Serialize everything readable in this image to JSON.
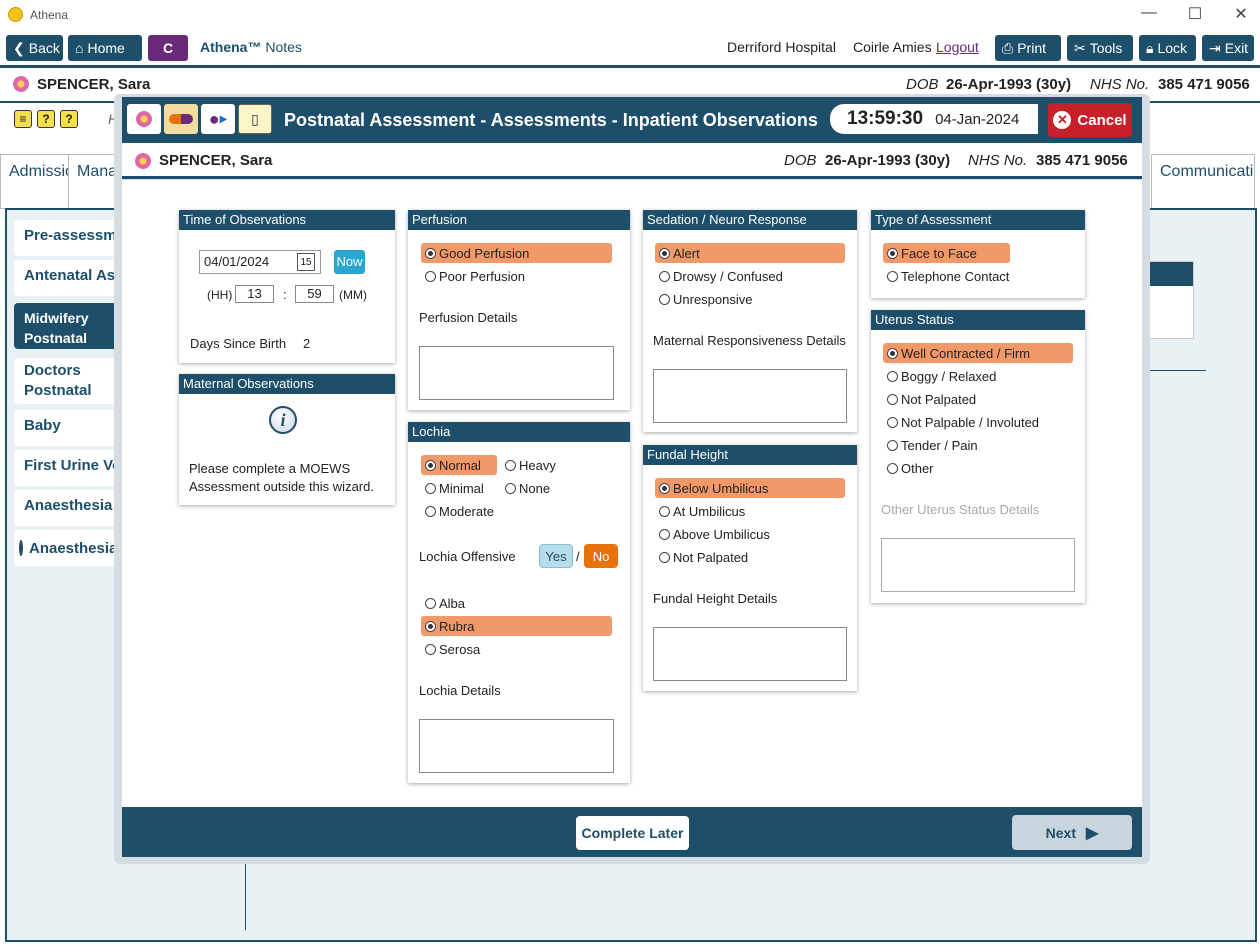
{
  "app": {
    "title": "Athena"
  },
  "toolbar": {
    "back": "Back",
    "home": "Home",
    "c": "C",
    "app_name": "Athena™",
    "app_sub": "Notes",
    "hospital": "Derriford Hospital",
    "user": "Coirle Amies",
    "logout": "Logout",
    "print": "Print",
    "tools": "Tools",
    "lock": "Lock",
    "exit": "Exit"
  },
  "patient": {
    "name": "SPENCER, Sara",
    "dob_label": "DOB",
    "dob": "26-Apr-1993 (30y)",
    "nhs_label": "NHS No.",
    "nhs": "385 471 9056"
  },
  "bg_tabs": {
    "admission": "Admission",
    "management": "Management",
    "communications": "Communications",
    "h": "H"
  },
  "sidebar": [
    {
      "label": "Pre-assessment"
    },
    {
      "label": "Antenatal Assessments"
    },
    {
      "label": "Midwifery Postnatal Assessments"
    },
    {
      "label": "Doctors Postnatal Assessments"
    },
    {
      "label": "Baby"
    },
    {
      "label": "First Urine Void"
    },
    {
      "label": "Anaesthesia In"
    },
    {
      "label": "Anaesthesia"
    }
  ],
  "modal": {
    "title": "Postnatal Assessment - Assessments - Inpatient Observations",
    "time": "13:59:30",
    "date": "04-Jan-2024",
    "cancel": "Cancel"
  },
  "time_obs": {
    "header": "Time of Observations",
    "date": "04/01/2024",
    "now": "Now",
    "hh_label": "(HH)",
    "hh": "13",
    "sep": ":",
    "mm": "59",
    "mm_label": "(MM)",
    "days_label": "Days Since Birth",
    "days": "2"
  },
  "maternal": {
    "header": "Maternal Observations",
    "text": "Please complete a MOEWS Assessment outside this wizard."
  },
  "perfusion": {
    "header": "Perfusion",
    "options": [
      "Good Perfusion",
      "Poor Perfusion"
    ],
    "selected": "Good Perfusion",
    "details_label": "Perfusion Details"
  },
  "lochia": {
    "header": "Lochia",
    "options": [
      "Normal",
      "Heavy",
      "Minimal",
      "None",
      "Moderate"
    ],
    "selected": "Normal",
    "offensive_label": "Lochia Offensive",
    "yes": "Yes",
    "slash": "/",
    "no": "No",
    "offensive": "No",
    "types": [
      "Alba",
      "Rubra",
      "Serosa"
    ],
    "type_selected": "Rubra",
    "details_label": "Lochia Details"
  },
  "sedation": {
    "header": "Sedation / Neuro Response",
    "options": [
      "Alert",
      "Drowsy / Confused",
      "Unresponsive"
    ],
    "selected": "Alert",
    "details_label": "Maternal Responsiveness Details"
  },
  "fundal": {
    "header": "Fundal Height",
    "options": [
      "Below Umbilicus",
      "At Umbilicus",
      "Above Umbilicus",
      "Not Palpated"
    ],
    "selected": "Below Umbilicus",
    "details_label": "Fundal Height Details"
  },
  "assessment_type": {
    "header": "Type of Assessment",
    "options": [
      "Face to Face",
      "Telephone Contact"
    ],
    "selected": "Face to Face"
  },
  "uterus": {
    "header": "Uterus Status",
    "options": [
      "Well Contracted / Firm",
      "Boggy / Relaxed",
      "Not Palpated",
      "Not Palpable / Involuted",
      "Tender / Pain",
      "Other"
    ],
    "selected": "Well Contracted / Firm",
    "other_label": "Other Uterus Status Details"
  },
  "footer": {
    "complete_later": "Complete Later",
    "next": "Next"
  },
  "colors": {
    "navy": "#1d4f6b",
    "selected": "#f2996a",
    "no_active": "#e8730c",
    "cancel": "#c8202a"
  }
}
